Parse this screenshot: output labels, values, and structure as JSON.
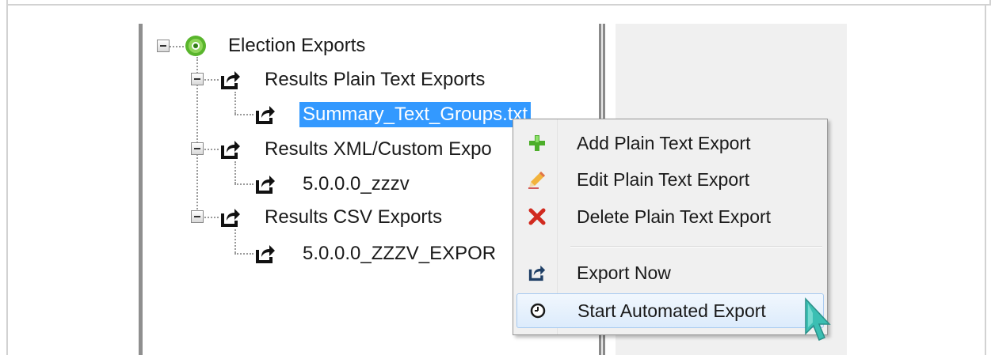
{
  "tree": {
    "root": {
      "label": "Election Exports"
    },
    "groups": [
      {
        "label": "Results Plain Text Exports",
        "children": [
          {
            "label": "Summary_Text_Groups.txt",
            "selected": true
          }
        ]
      },
      {
        "label": "Results XML/Custom Expo",
        "children": [
          {
            "label": "5.0.0.0_zzzv"
          }
        ]
      },
      {
        "label": "Results CSV Exports",
        "children": [
          {
            "label": "5.0.0.0_ZZZV_EXPOR"
          }
        ]
      }
    ]
  },
  "context_menu": {
    "items": [
      {
        "label": "Add Plain Text Export",
        "icon": "plus-icon"
      },
      {
        "label": "Edit Plain Text Export",
        "icon": "pencil-icon"
      },
      {
        "label": "Delete Plain Text Export",
        "icon": "delete-x-icon"
      },
      {
        "label": "Export Now",
        "icon": "export-share-icon"
      },
      {
        "label": "Start Automated Export",
        "icon": "clock-icon",
        "hovered": true
      }
    ]
  },
  "colors": {
    "selection": "#3399ff",
    "menu_hover_border": "#a6c9f0",
    "cursor": "#3bbfb3"
  }
}
